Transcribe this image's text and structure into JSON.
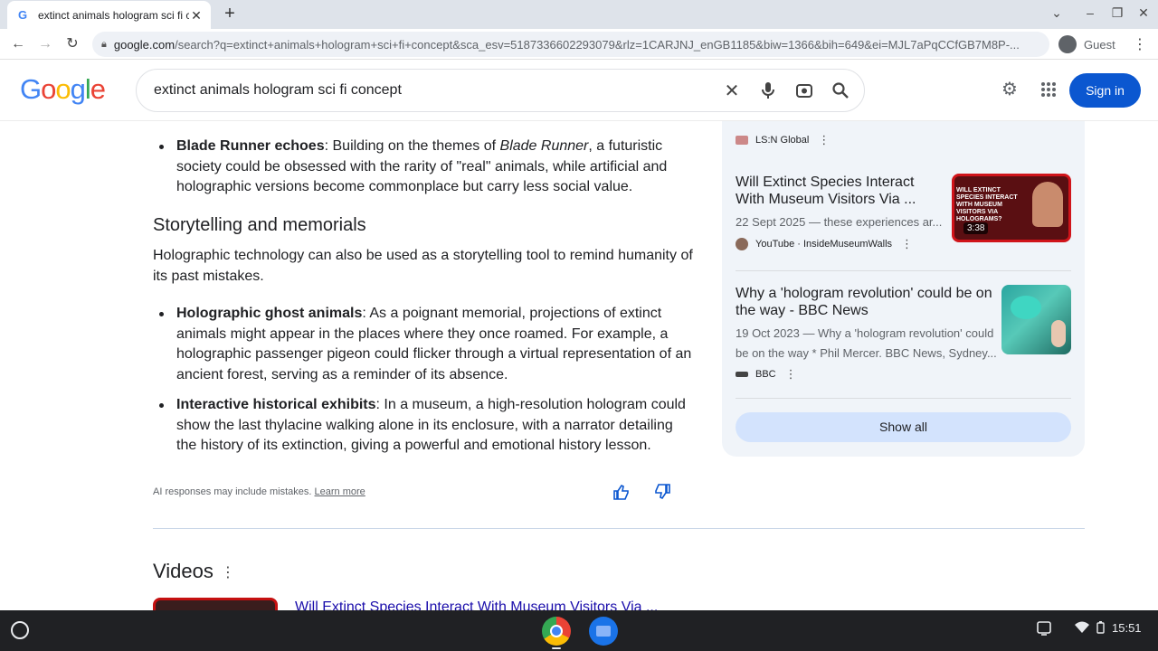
{
  "browser": {
    "tab_title": "extinct animals hologram sci fi c",
    "new_tab_label": "+",
    "url_host": "google.com",
    "url_path": "/search?q=extinct+animals+hologram+sci+fi+concept&sca_esv=5187336602293079&rlz=1CARJNJ_enGB1185&biw=1366&bih=649&ei=MJL7aPqCCfGB7M8P-...",
    "profile_label": "Guest"
  },
  "header": {
    "logo": [
      "G",
      "o",
      "o",
      "g",
      "l",
      "e"
    ],
    "query": "extinct animals hologram sci fi concept",
    "signin_label": "Sign in"
  },
  "main": {
    "bullet1_bold": "Blade Runner echoes",
    "bullet1_pre": ": Building on the themes of ",
    "bullet1_italic": "Blade Runner",
    "bullet1_post": ", a futuristic society could be obsessed with the rarity of \"real\" animals, while artificial and holographic versions become commonplace but carry less social value.",
    "section_title": "Storytelling and memorials",
    "section_para": "Holographic technology can also be used as a storytelling tool to remind humanity of its past mistakes.",
    "bullet2_bold": "Holographic ghost animals",
    "bullet2_text": ": As a poignant memorial, projections of extinct animals might appear in the places where they once roamed. For example, a holographic passenger pigeon could flicker through a virtual representation of an ancient forest, serving as a reminder of its absence.",
    "bullet3_bold": "Interactive historical exhibits",
    "bullet3_text": ": In a museum, a high-resolution hologram could show the last thylacine walking alone in its enclosure, with a narrator detailing the history of its extinction, giving a powerful and emotional history lesson.",
    "disclaimer": "AI responses may include mistakes.",
    "learn_more": "Learn more",
    "videos_heading": "Videos",
    "video_link": "Will Extinct Species Interact With Museum Visitors Via ..."
  },
  "panel": {
    "top_source": "LS:N Global",
    "card1_title": "Will Extinct Species Interact With Museum Visitors Via ...",
    "card1_meta": "22 Sept 2025 — these experiences ar...",
    "card1_source": "YouTube · InsideMuseumWalls",
    "card1_duration": "3:38",
    "card1_thumb_text": "WILL EXTINCT SPECIES INTERACT WITH MUSEUM VISITORS VIA HOLOGRAMS?",
    "card2_title": "Why a 'hologram revolution' could be on the way - BBC News",
    "card2_meta": "19 Oct 2023 — Why a 'hologram revolution' could be on the way * Phil Mercer. BBC News, Sydney...",
    "card2_source": "BBC",
    "show_all": "Show all"
  },
  "shelf": {
    "time": "15:51"
  }
}
